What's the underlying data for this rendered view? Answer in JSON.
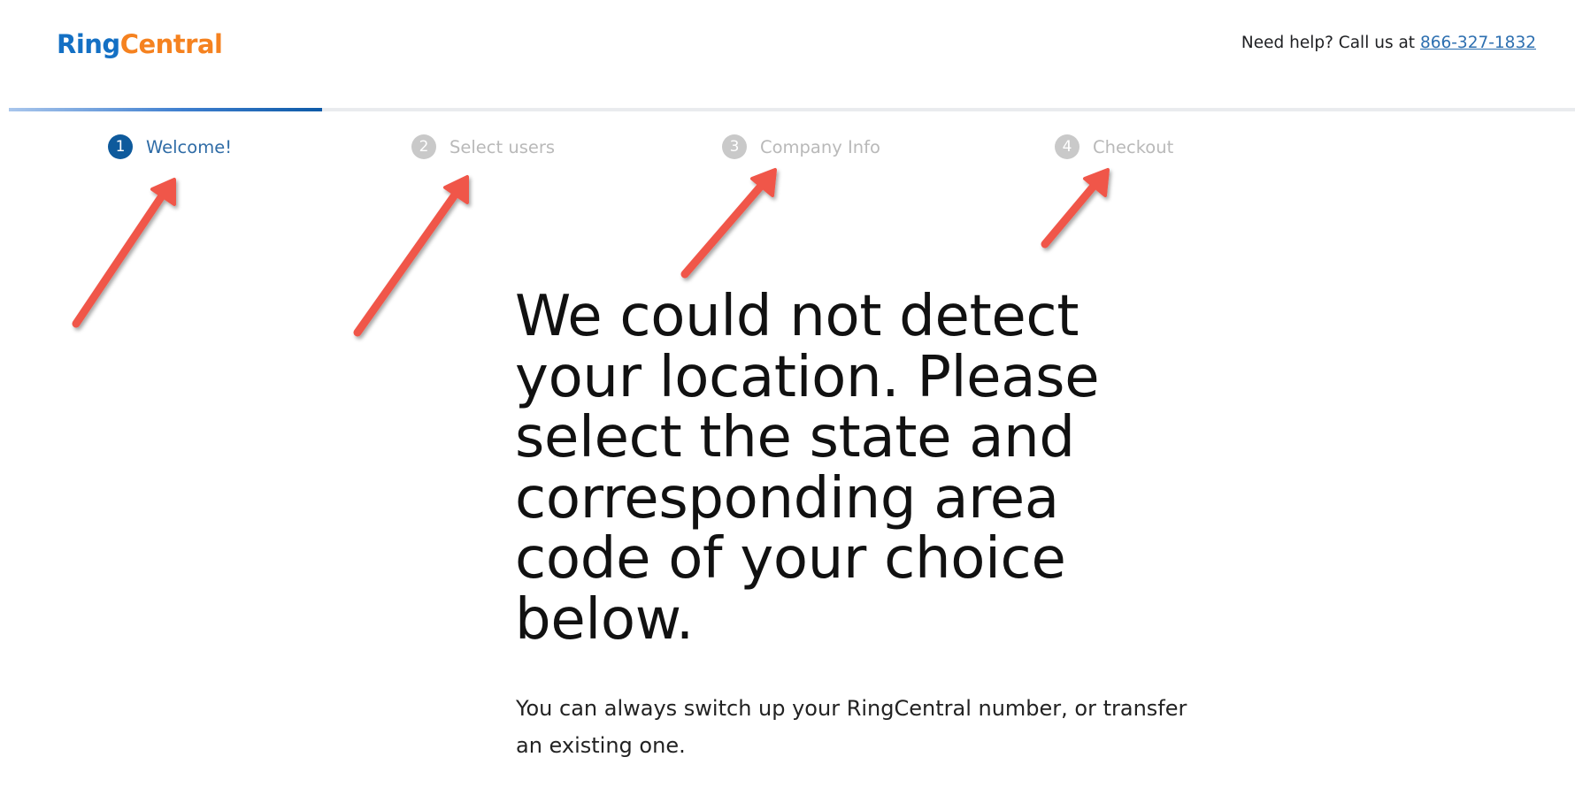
{
  "header": {
    "logo_ring": "Ring",
    "logo_central": "Central",
    "help_text": "Need help? Call us at ",
    "help_phone": "866-327-1832"
  },
  "progress": {
    "fraction": 0.2
  },
  "steps": [
    {
      "number": "1",
      "label": "Welcome!",
      "active": true
    },
    {
      "number": "2",
      "label": "Select users",
      "active": false
    },
    {
      "number": "3",
      "label": "Company Info",
      "active": false
    },
    {
      "number": "4",
      "label": "Checkout",
      "active": false
    }
  ],
  "main": {
    "headline": "We could not detect your location. Please select the state and corresponding area code of your choice below.",
    "subtext": "You can always switch up your RingCentral number, or transfer an existing one."
  },
  "colors": {
    "brand_blue": "#1470c4",
    "brand_orange": "#f58220",
    "active_step": "#0e5a9c",
    "inactive_step": "#c9c9c9",
    "annotation_arrow": "#f0564a"
  }
}
